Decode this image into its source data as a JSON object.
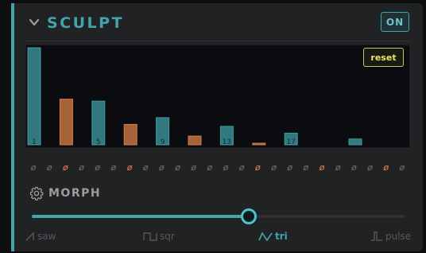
{
  "module": {
    "title": "SCULPT",
    "power_label": "ON"
  },
  "harmonic_graph": {
    "reset_label": "reset",
    "max_level": 1.0,
    "colors": {
      "positive": "#41a3ab",
      "inverted": "#e2854a"
    },
    "bars": [
      {
        "index": 1,
        "level": 1.0,
        "inverted": false,
        "label": "1"
      },
      {
        "index": 3,
        "level": 0.47,
        "inverted": true,
        "label": ""
      },
      {
        "index": 5,
        "level": 0.45,
        "inverted": false,
        "label": "5"
      },
      {
        "index": 7,
        "level": 0.21,
        "inverted": true,
        "label": ""
      },
      {
        "index": 9,
        "level": 0.28,
        "inverted": false,
        "label": "9"
      },
      {
        "index": 11,
        "level": 0.09,
        "inverted": true,
        "label": ""
      },
      {
        "index": 13,
        "level": 0.19,
        "inverted": false,
        "label": "13"
      },
      {
        "index": 15,
        "level": 0.015,
        "inverted": true,
        "label": ""
      },
      {
        "index": 17,
        "level": 0.12,
        "inverted": false,
        "label": "17"
      },
      {
        "index": 21,
        "level": 0.06,
        "inverted": false,
        "label": ""
      }
    ]
  },
  "phase_row": {
    "symbol": "ø",
    "count": 24,
    "highlighted": [
      3,
      7,
      15,
      19,
      23
    ]
  },
  "morph": {
    "label": "MORPH",
    "value": 0.58,
    "waveforms": [
      {
        "name": "saw",
        "icon": "saw-wave-icon",
        "active": false
      },
      {
        "name": "sqr",
        "icon": "square-wave-icon",
        "active": false
      },
      {
        "name": "tri",
        "icon": "triangle-wave-icon",
        "active": true
      },
      {
        "name": "pulse",
        "icon": "pulse-wave-icon",
        "active": false
      }
    ]
  }
}
